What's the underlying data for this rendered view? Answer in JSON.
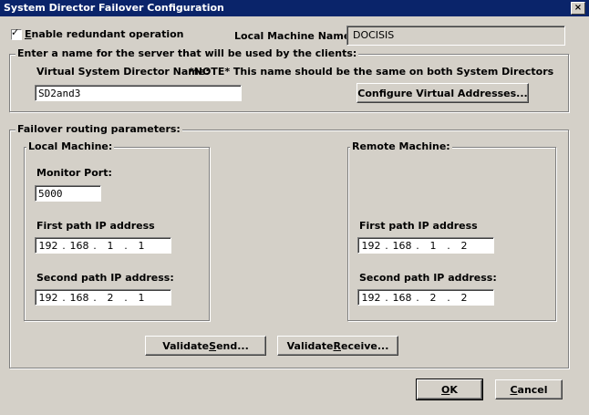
{
  "window": {
    "title": "System Director Failover Configuration",
    "close_glyph": "×"
  },
  "enable": {
    "checked": true,
    "tick": "✓",
    "label_prefix": "",
    "label_u": "E",
    "label_rest": "nable redundant operation"
  },
  "local_machine_name": {
    "label": "Local Machine Name:",
    "value": "DOCISIS"
  },
  "server_group": {
    "legend": "Enter a name for the server that will be used by the clients:",
    "vsd_label": "Virtual System Director Name:",
    "note": "*NOTE* This name should be the same on both System Directors",
    "vsd_value": "SD2and3",
    "configure_button": "Configure Virtual Addresses..."
  },
  "failover_group": {
    "legend": "Failover routing parameters:"
  },
  "local": {
    "legend": "Local Machine:",
    "monitor_port_label": "Monitor Port:",
    "monitor_port_value": "5000",
    "first_label": "First path IP address",
    "first_ip": [
      "192",
      "168",
      "1",
      "1"
    ],
    "second_label": "Second path IP address:",
    "second_ip": [
      "192",
      "168",
      "2",
      "1"
    ]
  },
  "remote": {
    "legend": "Remote Machine:",
    "first_label": "First path  IP address",
    "first_ip": [
      "192",
      "168",
      "1",
      "2"
    ],
    "second_label": "Second path IP address:",
    "second_ip": [
      "192",
      "168",
      "2",
      "2"
    ]
  },
  "buttons": {
    "validate_send_prefix": "Validate ",
    "validate_send_u": "S",
    "validate_send_rest": "end...",
    "validate_receive_prefix": "Validate ",
    "validate_receive_u": "R",
    "validate_receive_rest": "eceive...",
    "ok_u": "O",
    "ok_rest": "K",
    "cancel_u": "C",
    "cancel_rest": "ancel"
  },
  "dot": "."
}
